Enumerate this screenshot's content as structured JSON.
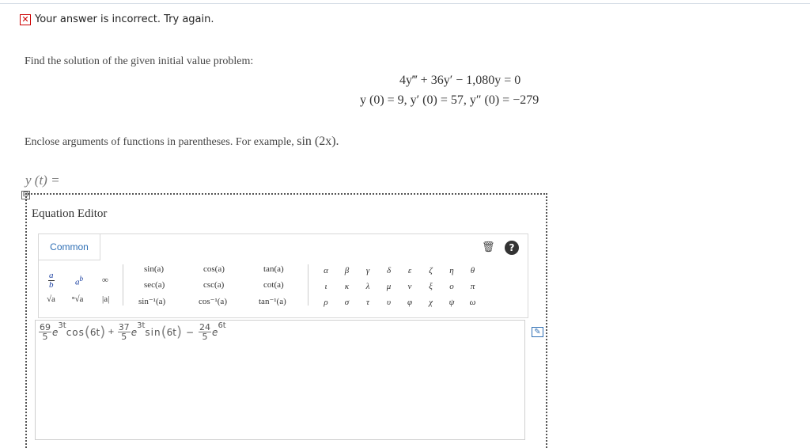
{
  "status": {
    "text": "Your answer is incorrect.  Try again.",
    "icon": "x-icon",
    "color": "#cc0000"
  },
  "problem": {
    "instruction": "Find the solution of the given initial value problem:",
    "equation": "4y‴ + 36y′ − 1,080y = 0",
    "initial_conditions": "y (0) = 9,  y′ (0) = 57,  y″ (0) = −279",
    "note": "Enclose arguments of functions in parentheses. For example,",
    "note_example": "sin (2x)."
  },
  "answer_label": "y (t) =",
  "collapse_symbol": "⊟",
  "editor": {
    "title": "Equation Editor",
    "tab": "Common",
    "templates": {
      "frac_num": "a",
      "frac_den": "b",
      "pow_base": "a",
      "pow_exp": "b",
      "infinity": "∞",
      "sqrt": "√a",
      "nroot": "ⁿ√a",
      "abs": "|a|"
    },
    "functions": [
      [
        "sin(a)",
        "cos(a)",
        "tan(a)"
      ],
      [
        "sec(a)",
        "csc(a)",
        "cot(a)"
      ],
      [
        "sin⁻¹(a)",
        "cos⁻¹(a)",
        "tan⁻¹(a)"
      ]
    ],
    "greek": [
      [
        "α",
        "β",
        "γ",
        "δ",
        "ε",
        "ζ",
        "η",
        "θ"
      ],
      [
        "ι",
        "κ",
        "λ",
        "μ",
        "ν",
        "ξ",
        "ο",
        "π"
      ],
      [
        "ρ",
        "σ",
        "τ",
        "υ",
        "φ",
        "χ",
        "ψ",
        "ω"
      ]
    ],
    "trash_icon": "trash-icon",
    "help_label": "?",
    "answer": {
      "t1_num": "69",
      "t1_den": "5",
      "t1_exp": "3t",
      "t1_fn": "cos",
      "t1_arg": "6t",
      "t2_num": "37",
      "t2_den": "5",
      "t2_exp": "3t",
      "t2_fn": "sin",
      "t2_arg": "6t",
      "t3_num": "24",
      "t3_den": "5",
      "t3_exp": "6t",
      "e": "e",
      "plus": "+",
      "minus": "−"
    }
  }
}
